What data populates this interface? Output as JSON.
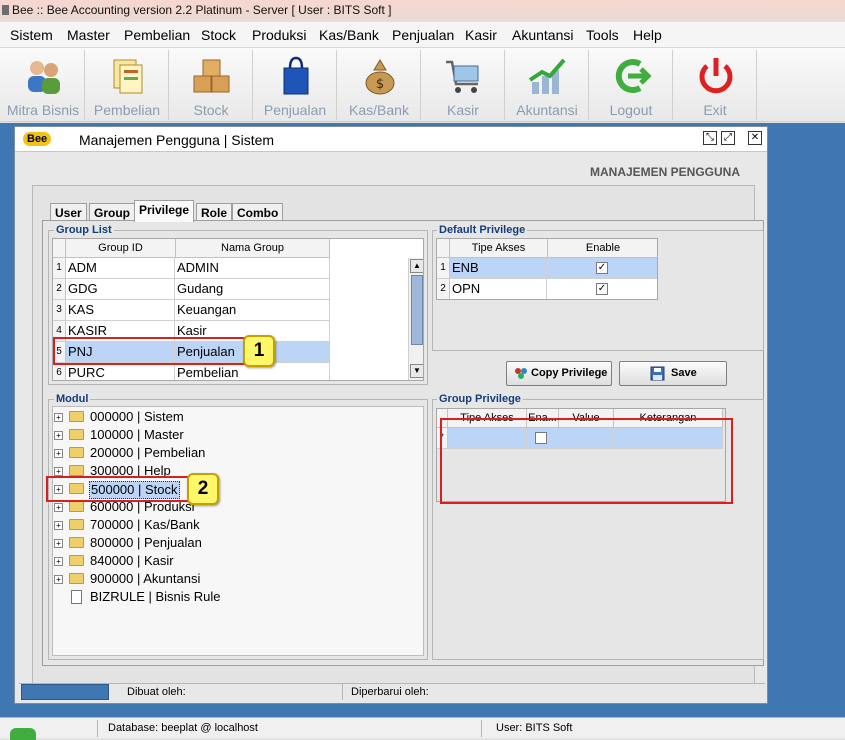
{
  "titlebar": {
    "text": "Bee :: Bee Accounting version 2.2 Platinum - Server  [ User : BITS Soft ]"
  },
  "menu": [
    "Sistem",
    "Master",
    "Pembelian",
    "Stock",
    "Produksi",
    "Kas/Bank",
    "Penjualan",
    "Kasir",
    "Akuntansi",
    "Tools",
    "Help"
  ],
  "toolbar": [
    {
      "label": "Mitra Bisnis",
      "icon": "users-icon"
    },
    {
      "label": "Pembelian",
      "icon": "documents-icon"
    },
    {
      "label": "Stock",
      "icon": "boxes-icon"
    },
    {
      "label": "Penjualan",
      "icon": "shopping-bag-icon"
    },
    {
      "label": "Kas/Bank",
      "icon": "money-bag-icon"
    },
    {
      "label": "Kasir",
      "icon": "cart-icon"
    },
    {
      "label": "Akuntansi",
      "icon": "chart-icon"
    },
    {
      "label": "Logout",
      "icon": "logout-icon"
    },
    {
      "label": "Exit",
      "icon": "power-icon"
    }
  ],
  "window": {
    "logo": "Bee",
    "title": "Manajemen Pengguna | Sistem",
    "header": "MANAJEMEN PENGGUNA"
  },
  "tabs": [
    "User",
    "Group",
    "Privilege",
    "Role",
    "Combo"
  ],
  "active_tab": "Privilege",
  "group_list": {
    "title": "Group List",
    "columns": [
      "Group ID",
      "Nama Group"
    ],
    "rows": [
      {
        "num": "1",
        "id": "ADM",
        "name": "ADMIN"
      },
      {
        "num": "2",
        "id": "GDG",
        "name": "Gudang"
      },
      {
        "num": "3",
        "id": "KAS",
        "name": "Keuangan"
      },
      {
        "num": "4",
        "id": "KASIR",
        "name": "Kasir"
      },
      {
        "num": "5",
        "id": "PNJ",
        "name": "Penjualan"
      },
      {
        "num": "6",
        "id": "PURC",
        "name": "Pembelian"
      }
    ],
    "selected": "PNJ"
  },
  "default_privilege": {
    "title": "Default Privilege",
    "columns": [
      "Tipe Akses",
      "Enable"
    ],
    "rows": [
      {
        "num": "1",
        "tipe": "ENB",
        "enable": true
      },
      {
        "num": "2",
        "tipe": "OPN",
        "enable": true
      }
    ]
  },
  "buttons": {
    "copy": "Copy Privilege",
    "save": "Save"
  },
  "modul": {
    "title": "Modul",
    "items": [
      {
        "label": "000000 | Sistem",
        "expandable": true
      },
      {
        "label": "100000 | Master",
        "expandable": true
      },
      {
        "label": "200000 | Pembelian",
        "expandable": true
      },
      {
        "label": "300000 | Help",
        "expandable": true
      },
      {
        "label": "500000 | Stock",
        "expandable": true
      },
      {
        "label": "600000 | Produksi",
        "expandable": true
      },
      {
        "label": "700000 | Kas/Bank",
        "expandable": true
      },
      {
        "label": "800000 | Penjualan",
        "expandable": true
      },
      {
        "label": "840000 | Kasir",
        "expandable": true
      },
      {
        "label": "900000 | Akuntansi",
        "expandable": true
      },
      {
        "label": "BIZRULE | Bisnis Rule",
        "expandable": false
      }
    ],
    "selected": "500000 | Stock"
  },
  "group_privilege": {
    "title": "Group Privilege",
    "columns": [
      "Tipe Akses",
      "Ena...",
      "Value",
      "Keterangan"
    ],
    "new_row_marker": "*"
  },
  "callouts": [
    "1",
    "2"
  ],
  "window_status": {
    "created_by": "Dibuat oleh:",
    "updated_by": "Diperbarui oleh:"
  },
  "app_status": {
    "database": "Database: beeplat @ localhost",
    "user": "User: BITS Soft"
  },
  "colors": {
    "desktop": "#3f77b3",
    "selection": "#bcd4f6",
    "callout_border": "#d9201e",
    "badge": "#fff76a"
  }
}
